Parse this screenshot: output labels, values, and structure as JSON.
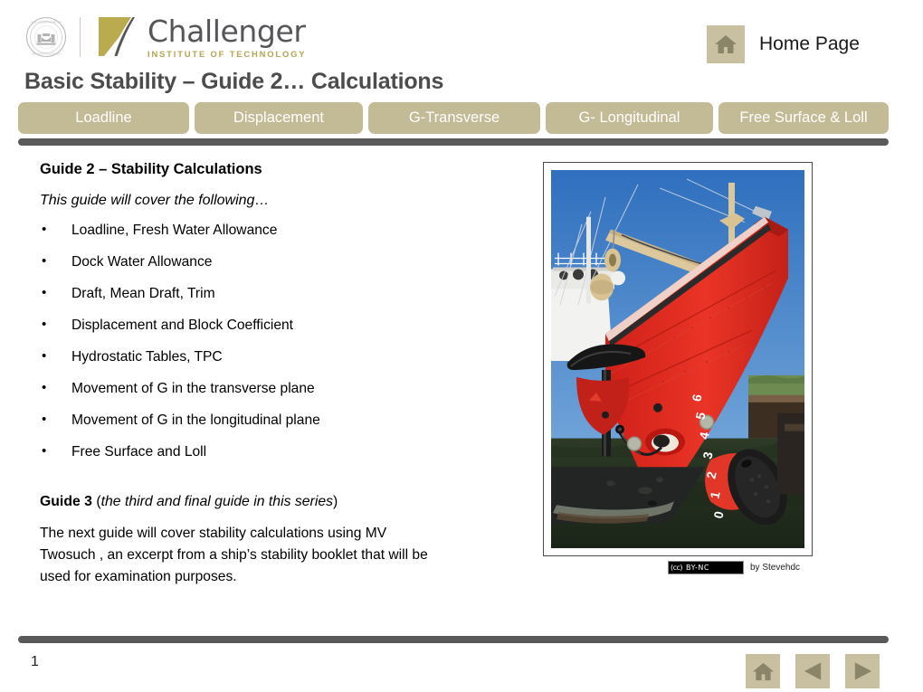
{
  "header": {
    "org_crest_alt": "Government of Western Australia crest",
    "brand_name": "Challenger",
    "brand_tagline": "INSTITUTE OF TECHNOLOGY",
    "home_link_label": "Home Page",
    "home_icon": "home-icon"
  },
  "slide": {
    "title": "Basic Stability – Guide 2… Calculations",
    "page_number": "1"
  },
  "tabs": [
    {
      "label": "Loadline"
    },
    {
      "label": "Displacement"
    },
    {
      "label": "G-Transverse"
    },
    {
      "label": "G- Longitudinal"
    },
    {
      "label": "Free Surface & Loll"
    }
  ],
  "content": {
    "guide_heading": "Guide 2 – Stability Calculations",
    "guide_intro": "This guide will cover the following…",
    "topics": [
      "Loadline, Fresh Water Allowance",
      "Dock Water Allowance",
      "Draft, Mean Draft, Trim",
      "Displacement and Block Coefficient",
      "Hydrostatic Tables, TPC",
      "Movement of G in the transverse plane",
      "Movement of G in the longitudinal plane",
      "Free Surface and Loll"
    ],
    "guide3_label": "Guide 3",
    "guide3_paren_open": " (",
    "guide3_italic": "the third and final guide in this series",
    "guide3_paren_close": ")",
    "guide3_body": "The next guide will cover stability calculations  using MV Twosuch , an excerpt from a ship’s stability booklet that will be used for examination purposes."
  },
  "photo": {
    "alt": "Red ship bow with draft marks at a dock",
    "draft_marks": [
      "6",
      "5",
      "4",
      "3",
      "2",
      "1",
      "0"
    ],
    "credit_cc_symbol": "(cc)",
    "credit_license": "BY-NC",
    "credit_author": "by Stevehdc"
  },
  "footer": {
    "nav": [
      {
        "name": "home",
        "icon": "home-icon"
      },
      {
        "name": "previous",
        "icon": "triangle-left-icon"
      },
      {
        "name": "next",
        "icon": "triangle-right-icon"
      }
    ]
  },
  "colors": {
    "tab_tan": "#c3ba96",
    "tile_tan": "#c8c0a0",
    "tile_icon": "#8a8468",
    "rule_grey": "#595959",
    "title_grey": "#4c4c4c",
    "brand_grey": "#56565a",
    "brand_gold": "#b3a553"
  }
}
